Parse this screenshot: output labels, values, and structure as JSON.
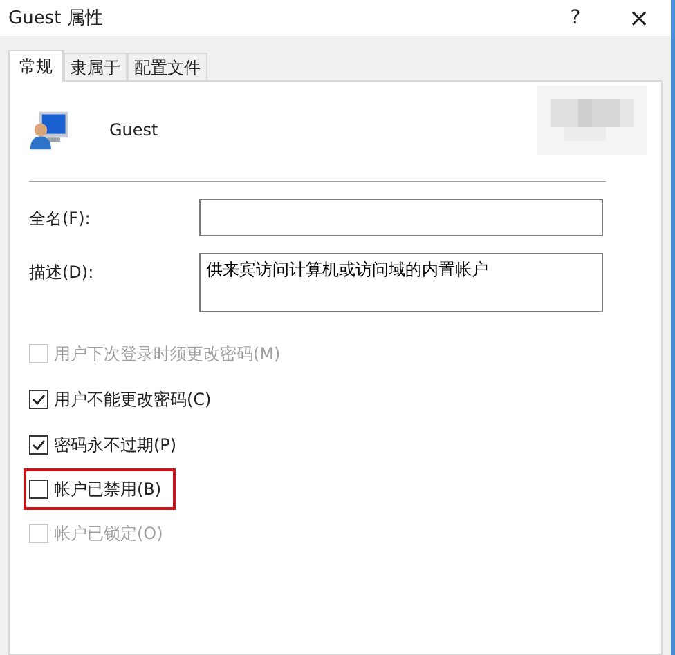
{
  "window": {
    "title": "Guest 属性",
    "help": "?",
    "close": "×"
  },
  "tabs": [
    {
      "label": "常规",
      "selected": true
    },
    {
      "label": "隶属于",
      "selected": false
    },
    {
      "label": "配置文件",
      "selected": false
    }
  ],
  "user": {
    "name": "Guest"
  },
  "fields": [
    {
      "label": "全名(F):",
      "kind": "line"
    },
    {
      "label": "描述(D):",
      "value": "供来宾访问计算机或访问域的内置帐户",
      "kind": "area"
    }
  ],
  "options": [
    {
      "label": "用户下次登录时须更改密码(M)",
      "checked": false,
      "disabled": true,
      "highlighted": false
    },
    {
      "label": "用户不能更改密码(C)",
      "checked": true,
      "disabled": false,
      "highlighted": false
    },
    {
      "label": "密码永不过期(P)",
      "checked": true,
      "disabled": false,
      "highlighted": false
    },
    {
      "label": "帐户已禁用(B)",
      "checked": false,
      "disabled": false,
      "highlighted": true
    },
    {
      "label": "帐户已锁定(O)",
      "checked": false,
      "disabled": true,
      "highlighted": false
    }
  ]
}
